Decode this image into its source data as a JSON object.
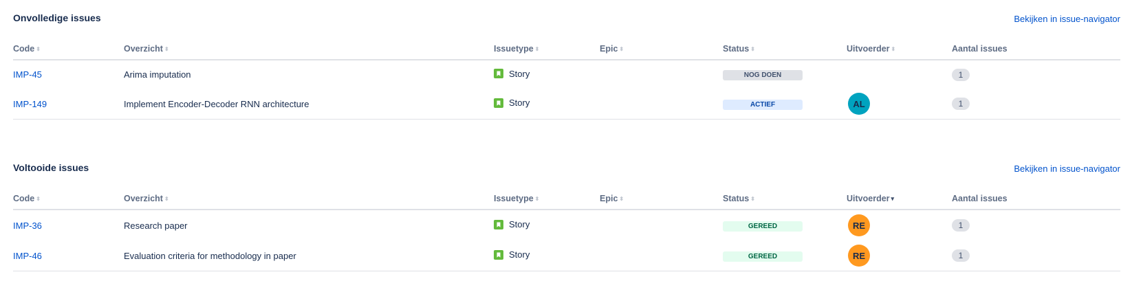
{
  "colors": {
    "link": "#0052cc",
    "story_icon": "#63ba3c",
    "todo_bg": "#dfe1e6",
    "todo_text": "#42526e",
    "active_bg": "#deebff",
    "active_text": "#0747a6",
    "done_bg": "#e3fcef",
    "done_text": "#006644",
    "avatar_al": "#00a3bf",
    "avatar_re": "#ff991f"
  },
  "columns": {
    "code": "Code",
    "overview": "Overzicht",
    "issuetype": "Issuetype",
    "epic": "Epic",
    "status": "Status",
    "assignee": "Uitvoerder",
    "count": "Aantal issues"
  },
  "incomplete": {
    "title": "Onvolledige issues",
    "link": "Bekijken in issue-navigator",
    "rows": [
      {
        "code": "IMP-45",
        "summary": "Arima imputation",
        "type": "Story",
        "icon": "story-icon",
        "epic": "",
        "status": "NOG DOEN",
        "status_kind": "todo",
        "assignee": "",
        "count": "1"
      },
      {
        "code": "IMP-149",
        "summary": "Implement Encoder-Decoder RNN architecture",
        "type": "Story",
        "icon": "story-icon",
        "epic": "",
        "status": "ACTIEF",
        "status_kind": "active",
        "assignee": "AL",
        "count": "1"
      }
    ]
  },
  "complete": {
    "title": "Voltooide issues",
    "link": "Bekijken in issue-navigator",
    "rows": [
      {
        "code": "IMP-36",
        "summary": "Research paper",
        "type": "Story",
        "icon": "story-icon",
        "epic": "",
        "status": "GEREED",
        "status_kind": "done",
        "assignee": "RE",
        "count": "1"
      },
      {
        "code": "IMP-46",
        "summary": "Evaluation criteria for methodology in paper",
        "type": "Story",
        "icon": "story-icon",
        "epic": "",
        "status": "GEREED",
        "status_kind": "done",
        "assignee": "RE",
        "count": "1"
      }
    ]
  }
}
